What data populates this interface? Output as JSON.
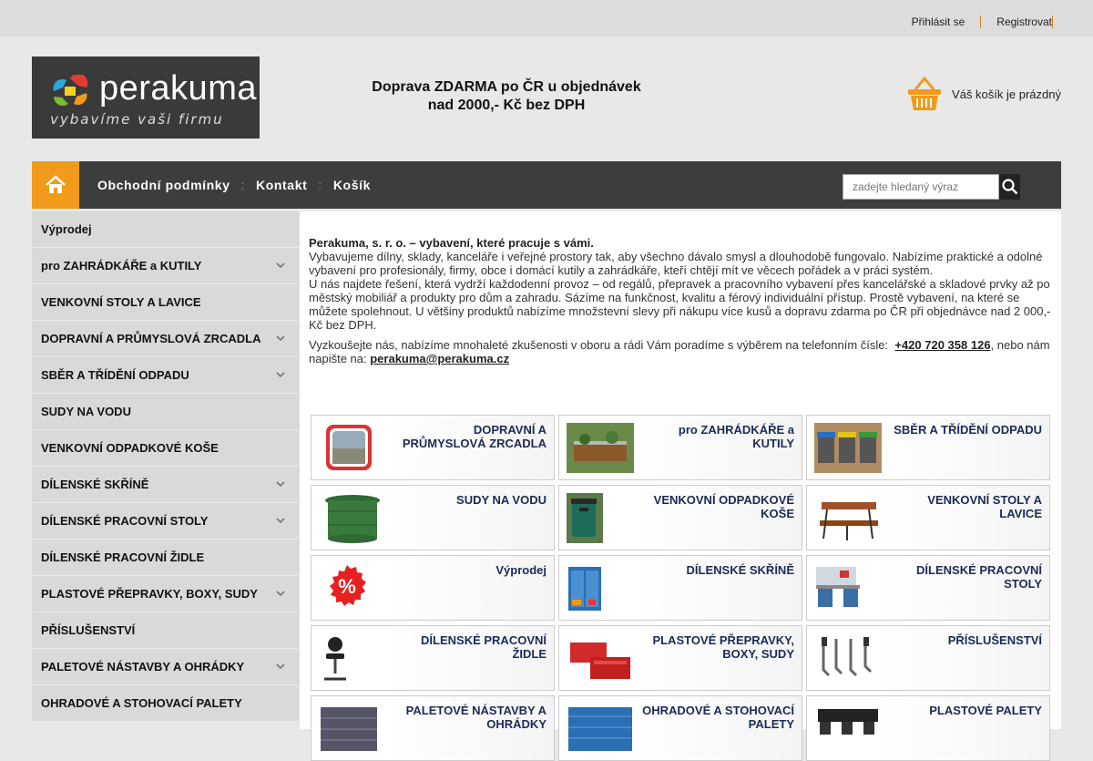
{
  "topbar": {
    "login": "Přihlásit se",
    "register": "Registrovat"
  },
  "logo": {
    "name": "perakuma",
    "tagline": "vybavíme vaši firmu"
  },
  "promo": {
    "text": "Doprava ZDARMA po ČR u objednávek nad 2000,- Kč bez DPH"
  },
  "cart": {
    "label": "Váš košík je prázdný",
    "icon": "basket-icon"
  },
  "nav": {
    "items": [
      "Obchodní podmínky",
      "Kontakt",
      "Košík"
    ],
    "separator": ":",
    "search_placeholder": "zadejte hledaný výraz"
  },
  "sidebar": {
    "items": [
      {
        "label": "Výprodej",
        "expandable": false
      },
      {
        "label": "pro ZAHRÁDKÁŘE a KUTILY",
        "expandable": true
      },
      {
        "label": "VENKOVNÍ STOLY A LAVICE",
        "expandable": false
      },
      {
        "label": "DOPRAVNÍ A PRŮMYSLOVÁ ZRCADLA",
        "expandable": true
      },
      {
        "label": "SBĚR A TŘÍDĚNÍ ODPADU",
        "expandable": true
      },
      {
        "label": "SUDY NA VODU",
        "expandable": false
      },
      {
        "label": "VENKOVNÍ ODPADKOVÉ KOŠE",
        "expandable": false
      },
      {
        "label": "DÍLENSKÉ SKŘÍNĚ",
        "expandable": true
      },
      {
        "label": "DÍLENSKÉ PRACOVNÍ STOLY",
        "expandable": true
      },
      {
        "label": "DÍLENSKÉ PRACOVNÍ ŽIDLE",
        "expandable": false
      },
      {
        "label": "PLASTOVÉ PŘEPRAVKY, BOXY, SUDY",
        "expandable": true
      },
      {
        "label": "PŘÍSLUŠENSTVÍ",
        "expandable": false
      },
      {
        "label": "PALETOVÉ NÁSTAVBY A OHRÁDKY",
        "expandable": true
      },
      {
        "label": "OHRADOVÉ A STOHOVACÍ PALETY",
        "expandable": false
      }
    ]
  },
  "intro": {
    "heading": "Perakuma, s. r. o. – vybavení, které pracuje s vámi.",
    "p1": "Vybavujeme dílny, sklady, kanceláře i veřejné prostory tak, aby všechno dávalo smysl a dlouhodobě fungovalo. Nabízíme praktické a odolné vybavení pro profesionály, firmy, obce i domácí kutily a zahrádkáře, kteří chtějí mít ve věcech pořádek a v práci systém.",
    "p2": "U nás najdete řešení, která vydrží každodenní provoz – od regálů, přepravek a pracovního vybavení přes kancelářské a skladové prvky až po městský mobiliář a produkty pro dům a zahradu. Sázíme na funkčnost, kvalitu a férový individuální přístup. Prostě vybavení, na které se můžete spolehnout. U většiny produktů nabízíme množstevní slevy při nákupu více kusů a dopravu zdarma po ČR při objednávce nad 2 000,- Kč bez DPH.",
    "contact_pre": "Vyzkoušejte nás, nabízíme mnohaleté zkušenosti v oboru a rádi Vám poradíme s výběrem na telefonním čísle:",
    "phone": "+420 720 358 126",
    "contact_mid": ", nebo nám napište na:",
    "email": "perakuma@perakuma.cz"
  },
  "categories": [
    {
      "title": "DOPRAVNÍ A PRŮMYSLOVÁ ZRCADLA",
      "thumb": "mirror"
    },
    {
      "title": "pro ZAHRÁDKÁŘE a KUTILY",
      "thumb": "garden"
    },
    {
      "title": "SBĚR A TŘÍDĚNÍ ODPADU",
      "thumb": "bins"
    },
    {
      "title": "SUDY NA VODU",
      "thumb": "barrel"
    },
    {
      "title": "VENKOVNÍ ODPADKOVÉ KOŠE",
      "thumb": "trash"
    },
    {
      "title": "VENKOVNÍ STOLY A LAVICE",
      "thumb": "bench"
    },
    {
      "title": "Výprodej",
      "thumb": "sale"
    },
    {
      "title": "DÍLENSKÉ SKŘÍNĚ",
      "thumb": "cabinet"
    },
    {
      "title": "DÍLENSKÉ PRACOVNÍ STOLY",
      "thumb": "workbench"
    },
    {
      "title": "DÍLENSKÉ PRACOVNÍ ŽIDLE",
      "thumb": "chair"
    },
    {
      "title": "PLASTOVÉ PŘEPRAVKY, BOXY, SUDY",
      "thumb": "crates"
    },
    {
      "title": "PŘÍSLUŠENSTVÍ",
      "thumb": "hooks"
    },
    {
      "title": "PALETOVÉ NÁSTAVBY A OHRÁDKY",
      "thumb": "pallet-collar"
    },
    {
      "title": "OHRADOVÉ A STOHOVACÍ PALETY",
      "thumb": "stack-pallet"
    },
    {
      "title": "PLASTOVÉ PALETY",
      "thumb": "plastic-pallet"
    }
  ],
  "colors": {
    "accent": "#f29a1b",
    "nav_bg": "#3d3d3d",
    "category_title": "#1c2a55"
  }
}
